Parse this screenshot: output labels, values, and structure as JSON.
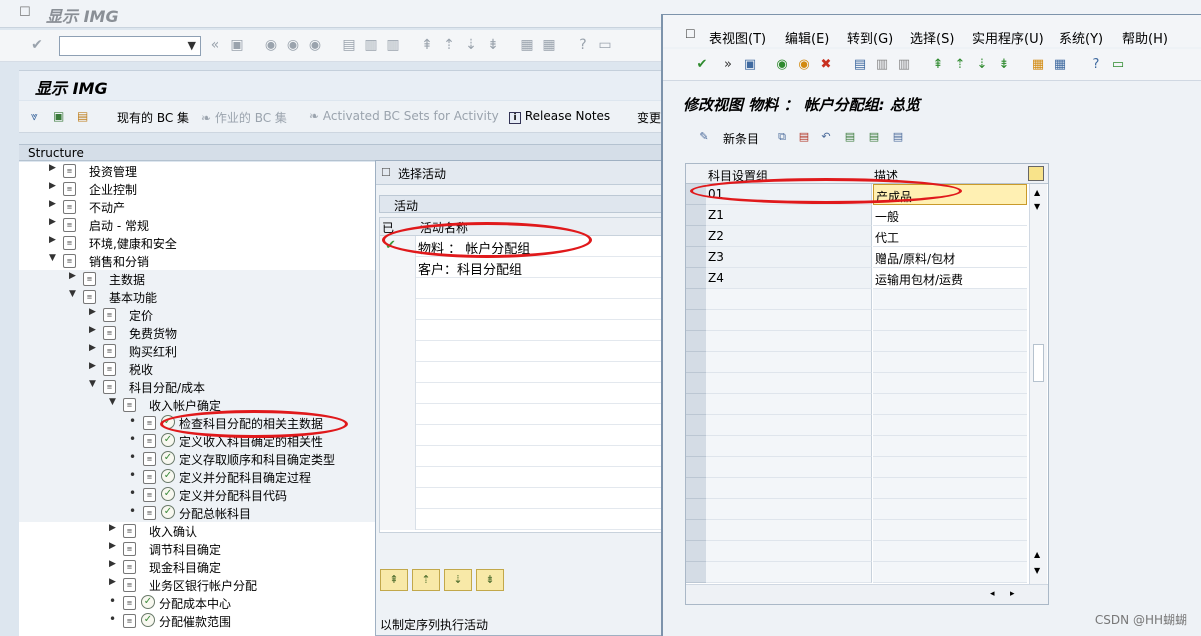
{
  "main": {
    "window_title": "显示 IMG",
    "img_title": "显示 IMG",
    "structure_label": "Structure",
    "toolbar": {
      "current_bc": "现有的 BC 集",
      "working_bc": "作业的 BC 集",
      "activated_bc": "Activated BC Sets for Activity",
      "release_notes": "Release Notes",
      "change": "变更"
    },
    "tree": [
      {
        "label": "投资管理",
        "level": 1,
        "type": "folder",
        "arrow": "collapsed"
      },
      {
        "label": "企业控制",
        "level": 1,
        "type": "folder",
        "arrow": "collapsed"
      },
      {
        "label": "不动产",
        "level": 1,
        "type": "folder",
        "arrow": "collapsed"
      },
      {
        "label": "启动 - 常规",
        "level": 1,
        "type": "folder",
        "arrow": "collapsed"
      },
      {
        "label": "环境,健康和安全",
        "level": 1,
        "type": "folder",
        "arrow": "collapsed"
      },
      {
        "label": "销售和分销",
        "level": 1,
        "type": "folder",
        "arrow": "expanded"
      },
      {
        "label": "主数据",
        "level": 2,
        "type": "folder",
        "arrow": "collapsed"
      },
      {
        "label": "基本功能",
        "level": 2,
        "type": "folder",
        "arrow": "expanded"
      },
      {
        "label": "定价",
        "level": 3,
        "type": "folder",
        "arrow": "collapsed"
      },
      {
        "label": "免费货物",
        "level": 3,
        "type": "folder",
        "arrow": "collapsed"
      },
      {
        "label": "购买红利",
        "level": 3,
        "type": "folder",
        "arrow": "collapsed"
      },
      {
        "label": "税收",
        "level": 3,
        "type": "folder",
        "arrow": "collapsed"
      },
      {
        "label": "科目分配/成本",
        "level": 3,
        "type": "folder",
        "arrow": "expanded"
      },
      {
        "label": "收入帐户确定",
        "level": 4,
        "type": "folder",
        "arrow": "expanded"
      },
      {
        "label": "检查科目分配的相关主数据",
        "level": 5,
        "type": "activity",
        "arrow": "dot"
      },
      {
        "label": "定义收入科目确定的相关性",
        "level": 5,
        "type": "activity",
        "arrow": "dot"
      },
      {
        "label": "定义存取顺序和科目确定类型",
        "level": 5,
        "type": "activity",
        "arrow": "dot"
      },
      {
        "label": "定义并分配科目确定过程",
        "level": 5,
        "type": "activity",
        "arrow": "dot"
      },
      {
        "label": "定义并分配科目代码",
        "level": 5,
        "type": "activity",
        "arrow": "dot"
      },
      {
        "label": "分配总帐科目",
        "level": 5,
        "type": "activity",
        "arrow": "dot"
      },
      {
        "label": "收入确认",
        "level": 4,
        "type": "folder",
        "arrow": "collapsed"
      },
      {
        "label": "调节科目确定",
        "level": 4,
        "type": "folder",
        "arrow": "collapsed"
      },
      {
        "label": "现金科目确定",
        "level": 4,
        "type": "folder",
        "arrow": "collapsed"
      },
      {
        "label": "业务区银行帐户分配",
        "level": 4,
        "type": "folder",
        "arrow": "collapsed"
      },
      {
        "label": "分配成本中心",
        "level": 4,
        "type": "activity",
        "arrow": "dot"
      },
      {
        "label": "分配催款范围",
        "level": 4,
        "type": "activity",
        "arrow": "dot"
      }
    ]
  },
  "activity_dialog": {
    "title": "选择活动",
    "group_title": "活动",
    "col_done": "已",
    "col_name": "活动名称",
    "rows": [
      {
        "name": "物料 ：  帐户分配组",
        "done": true
      },
      {
        "name": "客户：科目分配组",
        "done": false
      }
    ],
    "footer": "以制定序列执行活动"
  },
  "view_window": {
    "menu": [
      "表视图(T)",
      "编辑(E)",
      "转到(G)",
      "选择(S)",
      "实用程序(U)",
      "系统(Y)",
      "帮助(H)"
    ],
    "title": "修改视图 物料 ：  帐户分配组: 总览",
    "new_entries": "新条目",
    "columns": [
      "科目设置组",
      "描述"
    ],
    "rows": [
      {
        "code": "01",
        "desc": "产成品"
      },
      {
        "code": "Z1",
        "desc": "一般"
      },
      {
        "code": "Z2",
        "desc": "代工"
      },
      {
        "code": "Z3",
        "desc": "赠品/原料/包材"
      },
      {
        "code": "Z4",
        "desc": "运输用包材/运费"
      }
    ]
  },
  "watermark": "CSDN @HH蝴蝴",
  "colors": {
    "highlight_red": "#e0191b",
    "selected_cell": "#fff0b3",
    "title_gray": "#8a8f96"
  }
}
